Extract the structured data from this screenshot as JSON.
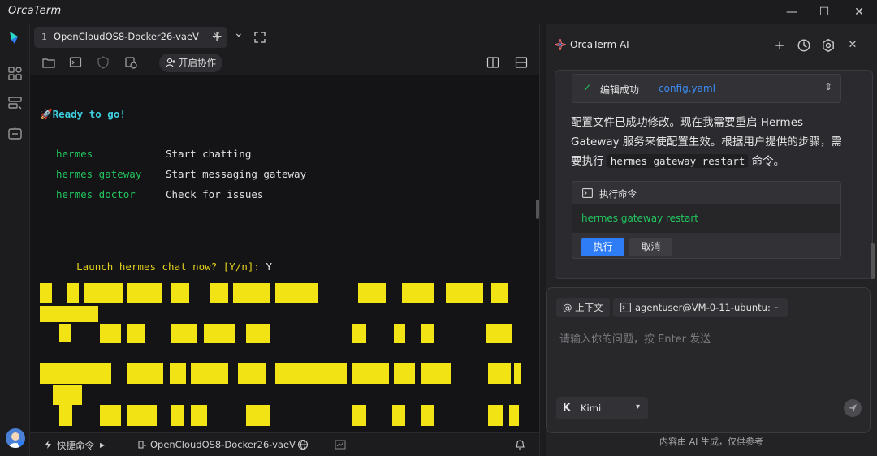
{
  "window": {
    "app_title": "OrcaTerm",
    "minimize": "—",
    "maximize": "☐",
    "close": "✕"
  },
  "tab": {
    "number": "1",
    "title": "OpenCloudOS8-Docker26-vaeV",
    "close": "×",
    "add": "+",
    "dropdown": "⌄"
  },
  "toolbar": {
    "collab_label": "开启协作"
  },
  "terminal": {
    "ready": "🚀Ready to go!",
    "commands": [
      {
        "cmd": "hermes",
        "desc": "Start chatting"
      },
      {
        "cmd": "hermes gateway",
        "desc": "Start messaging gateway"
      },
      {
        "cmd": "hermes doctor",
        "desc": "Check for issues"
      }
    ],
    "prompt": "Launch hermes chat now? [Y/n]:",
    "answer": "Y"
  },
  "statusbar": {
    "quick_cmd": "快捷命令",
    "session": "OpenCloudOS8-Docker26-vaeV"
  },
  "ai": {
    "title": "OrcaTerm AI",
    "edit_status": "编辑成功",
    "edit_file": "config.yaml",
    "message_part1": "配置文件已成功修改。现在我需要重启 Hermes Gateway 服务来使配置生效。根据用户提供的步骤，需要执行",
    "message_code": "hermes gateway restart",
    "message_part2": "命令。",
    "cmd_title": "执行命令",
    "cmd": "hermes gateway restart",
    "run_label": "执行",
    "cancel_label": "取消",
    "context_chip": "@ 上下文",
    "host_chip": "agentuser@VM-0-11-ubuntu: ~",
    "placeholder": "请输入你的问题，按 Enter 发送",
    "model_logo": "K",
    "model_name": "Kimi",
    "footer": "内容由 AI 生成，仅供参考"
  },
  "colors": {
    "accent": "#2f7df6",
    "success": "#22c55e",
    "banner": "#f1e314",
    "terminal_bg": "#141416"
  }
}
